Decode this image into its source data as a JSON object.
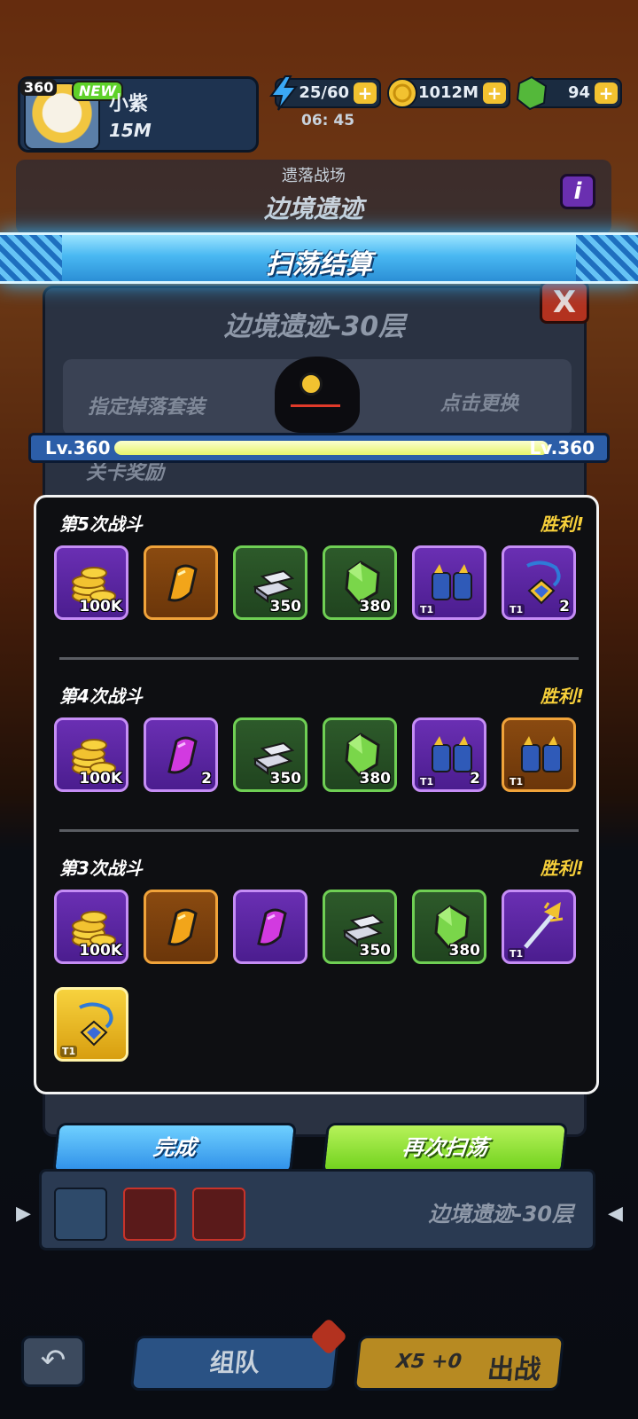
{
  "player": {
    "level": "360",
    "new_badge": "NEW",
    "name": "小紫",
    "power": "15M"
  },
  "resources": {
    "energy": "25/60",
    "energy_timer": "06: 45",
    "gold": "1012M",
    "gems": "94",
    "plus": "+"
  },
  "stage": {
    "mode": "遗落战场",
    "name": "边境遗迹",
    "info": "i"
  },
  "banner_title": "扫荡结算",
  "underlying_dialog": {
    "title": "边境遗迹-30层",
    "close": "X",
    "drop_set_label": "指定掉落套装",
    "change_label": "点击更换",
    "reward_label": "关卡奖励"
  },
  "level_bar": {
    "left": "Lv.360",
    "right": "Lv.360",
    "progress": 1.0
  },
  "battles": [
    {
      "title": "第5次战斗",
      "result": "胜利!",
      "items": [
        {
          "type": "gold-coins",
          "rarity": "purple",
          "qty": "100K",
          "tier": ""
        },
        {
          "type": "orange-shard",
          "rarity": "orange",
          "qty": "",
          "tier": ""
        },
        {
          "type": "silver-ingot",
          "rarity": "green",
          "qty": "350",
          "tier": ""
        },
        {
          "type": "green-gem",
          "rarity": "green",
          "qty": "380",
          "tier": ""
        },
        {
          "type": "gauntlets",
          "rarity": "purple",
          "qty": "",
          "tier": "T1"
        },
        {
          "type": "amulet",
          "rarity": "purple",
          "qty": "2",
          "tier": "T1"
        }
      ]
    },
    {
      "title": "第4次战斗",
      "result": "胜利!",
      "items": [
        {
          "type": "gold-coins",
          "rarity": "purple",
          "qty": "100K",
          "tier": ""
        },
        {
          "type": "purple-shard",
          "rarity": "purple",
          "qty": "2",
          "tier": ""
        },
        {
          "type": "silver-ingot",
          "rarity": "green",
          "qty": "350",
          "tier": ""
        },
        {
          "type": "green-gem",
          "rarity": "green",
          "qty": "380",
          "tier": ""
        },
        {
          "type": "gauntlets",
          "rarity": "purple",
          "qty": "2",
          "tier": "T1"
        },
        {
          "type": "gauntlets",
          "rarity": "orange",
          "qty": "",
          "tier": "T1"
        }
      ]
    },
    {
      "title": "第3次战斗",
      "result": "胜利!",
      "items": [
        {
          "type": "gold-coins",
          "rarity": "purple",
          "qty": "100K",
          "tier": ""
        },
        {
          "type": "orange-shard",
          "rarity": "orange",
          "qty": "",
          "tier": ""
        },
        {
          "type": "purple-shard",
          "rarity": "purple",
          "qty": "",
          "tier": ""
        },
        {
          "type": "silver-ingot",
          "rarity": "green",
          "qty": "350",
          "tier": ""
        },
        {
          "type": "green-gem",
          "rarity": "green",
          "qty": "380",
          "tier": ""
        },
        {
          "type": "trident",
          "rarity": "purple",
          "qty": "",
          "tier": "T1"
        },
        {
          "type": "amulet",
          "rarity": "gold",
          "qty": "",
          "tier": "T1"
        }
      ]
    }
  ],
  "buttons": {
    "done": "完成",
    "sweep_again": "再次扫荡"
  },
  "stage_selector": {
    "name": "边境遗迹-30层",
    "left_arrow": "▶",
    "right_arrow": "◀"
  },
  "bottom_nav": {
    "back": "↶",
    "team": "组队",
    "fight_cost": "X5 +0",
    "fight": "出战"
  },
  "colors": {
    "purple_frame": "#c58df5",
    "orange_frame": "#f0a33a",
    "green_frame": "#6fcf54",
    "victory": "#f6cf3a",
    "banner": "#49b8f2"
  }
}
